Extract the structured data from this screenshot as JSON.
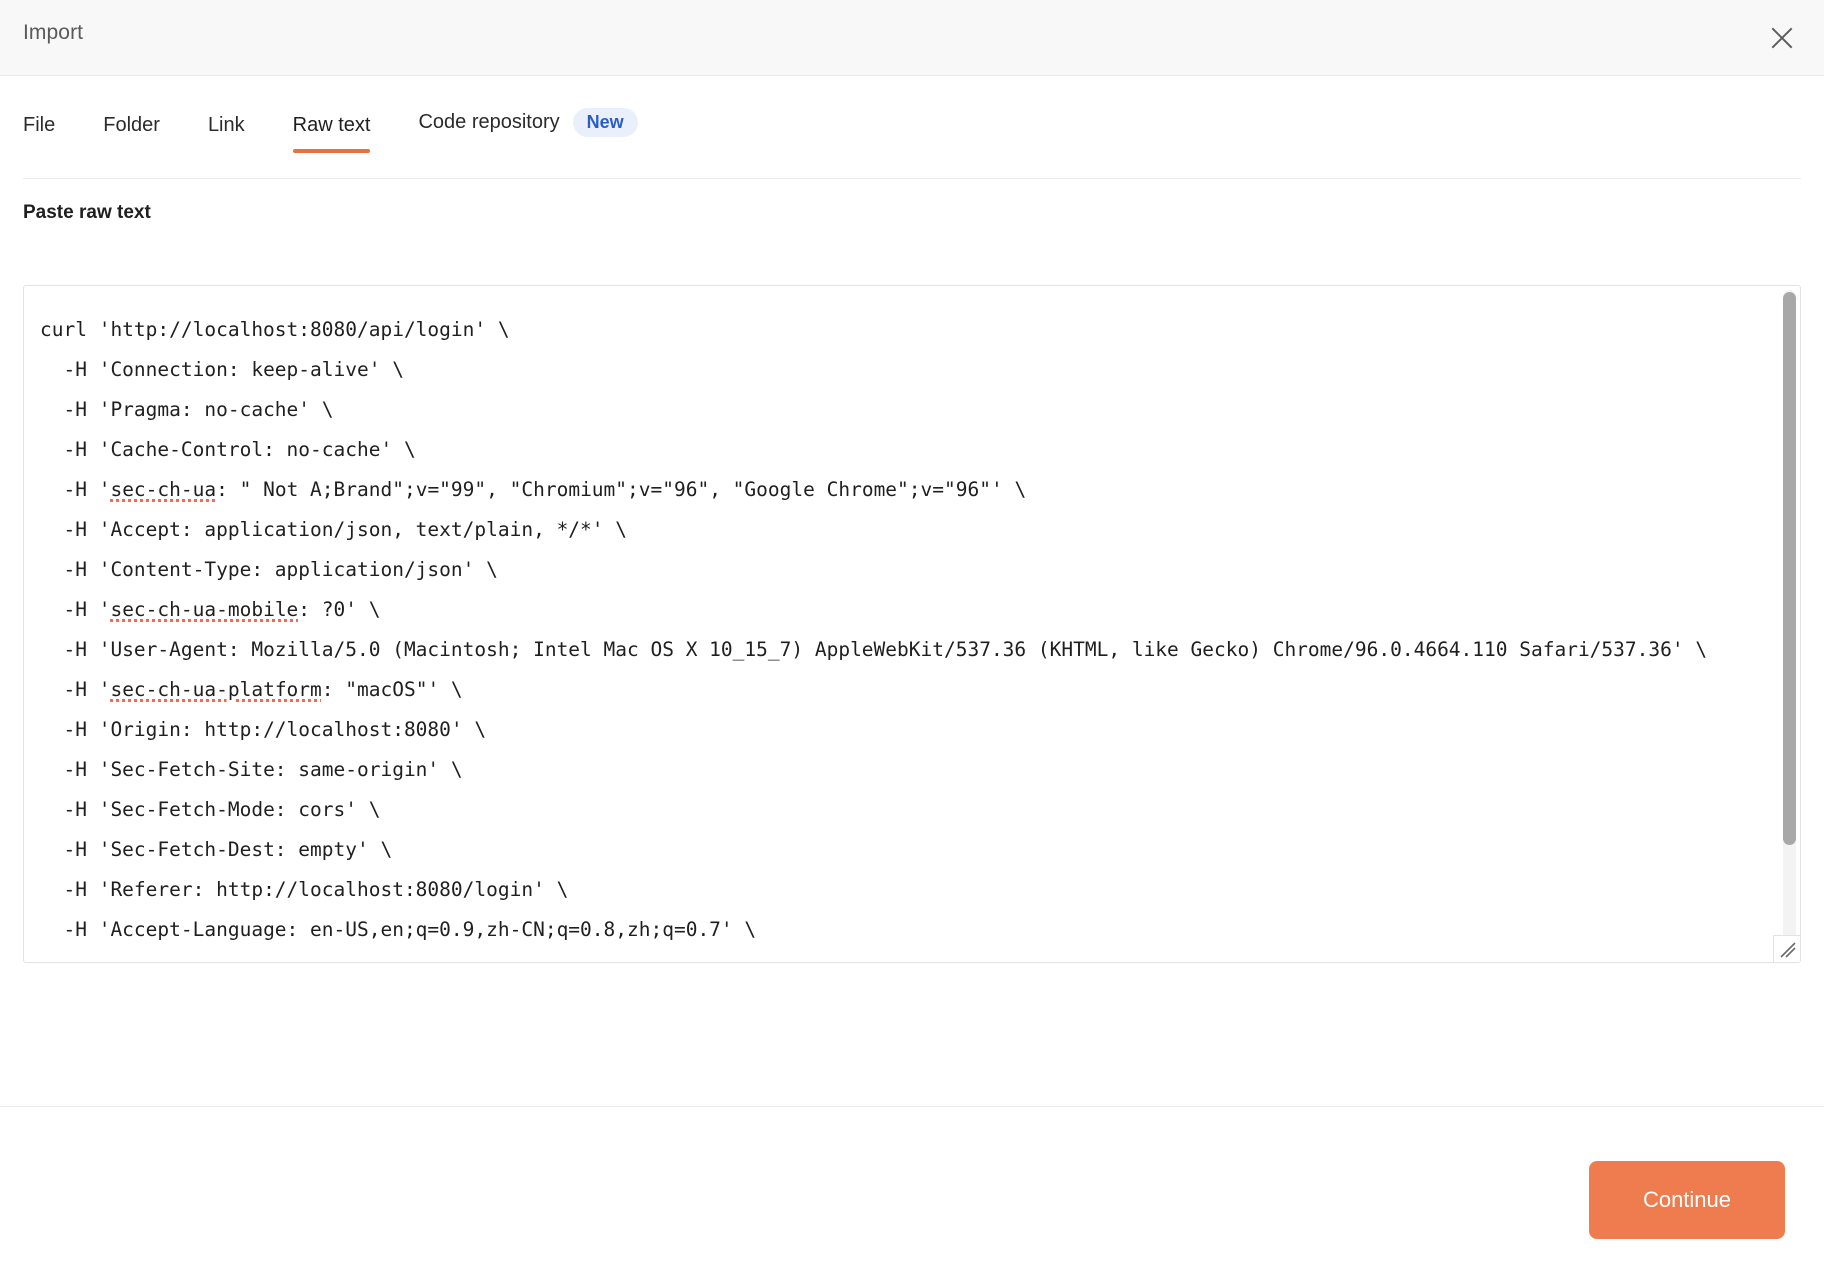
{
  "dialog": {
    "title": "Import",
    "close_icon": "close-icon"
  },
  "tabs": [
    {
      "label": "File",
      "active": false
    },
    {
      "label": "Folder",
      "active": false
    },
    {
      "label": "Link",
      "active": false
    },
    {
      "label": "Raw text",
      "active": true
    },
    {
      "label": "Code repository",
      "active": false,
      "badge": "New"
    }
  ],
  "form": {
    "label": "Paste raw text",
    "textarea": {
      "placeholder": "",
      "value_lines": [
        "curl 'http://localhost:8080/api/login' \\",
        "  -H 'Connection: keep-alive' \\",
        "  -H 'Pragma: no-cache' \\",
        "  -H 'Cache-Control: no-cache' \\",
        "  -H 'sec-ch-ua: \" Not A;Brand\";v=\"99\", \"Chromium\";v=\"96\", \"Google Chrome\";v=\"96\"' \\",
        "  -H 'Accept: application/json, text/plain, */*' \\",
        "  -H 'Content-Type: application/json' \\",
        "  -H 'sec-ch-ua-mobile: ?0' \\",
        "  -H 'User-Agent: Mozilla/5.0 (Macintosh; Intel Mac OS X 10_15_7) AppleWebKit/537.36 (KHTML, like Gecko) Chrome/96.0.4664.110 Safari/537.36' \\",
        "  -H 'sec-ch-ua-platform: \"macOS\"' \\",
        "  -H 'Origin: http://localhost:8080' \\",
        "  -H 'Sec-Fetch-Site: same-origin' \\",
        "  -H 'Sec-Fetch-Mode: cors' \\",
        "  -H 'Sec-Fetch-Dest: empty' \\",
        "  -H 'Referer: http://localhost:8080/login' \\",
        "  -H 'Accept-Language: en-US,en;q=0.9,zh-CN;q=0.8,zh;q=0.7' \\"
      ],
      "misspelled_tokens": [
        "sec-ch-ua",
        "sec-ch-ua-mobile",
        "sec-ch-ua-platform"
      ]
    }
  },
  "footer": {
    "continue_label": "Continue"
  },
  "colors": {
    "accent": "#e8713c",
    "button": "#ef7c4e",
    "badge_bg": "#e9f0fc",
    "badge_text": "#2c5cc5",
    "header_bg": "#f8f8f8",
    "spellcheck": "#f2695b"
  }
}
